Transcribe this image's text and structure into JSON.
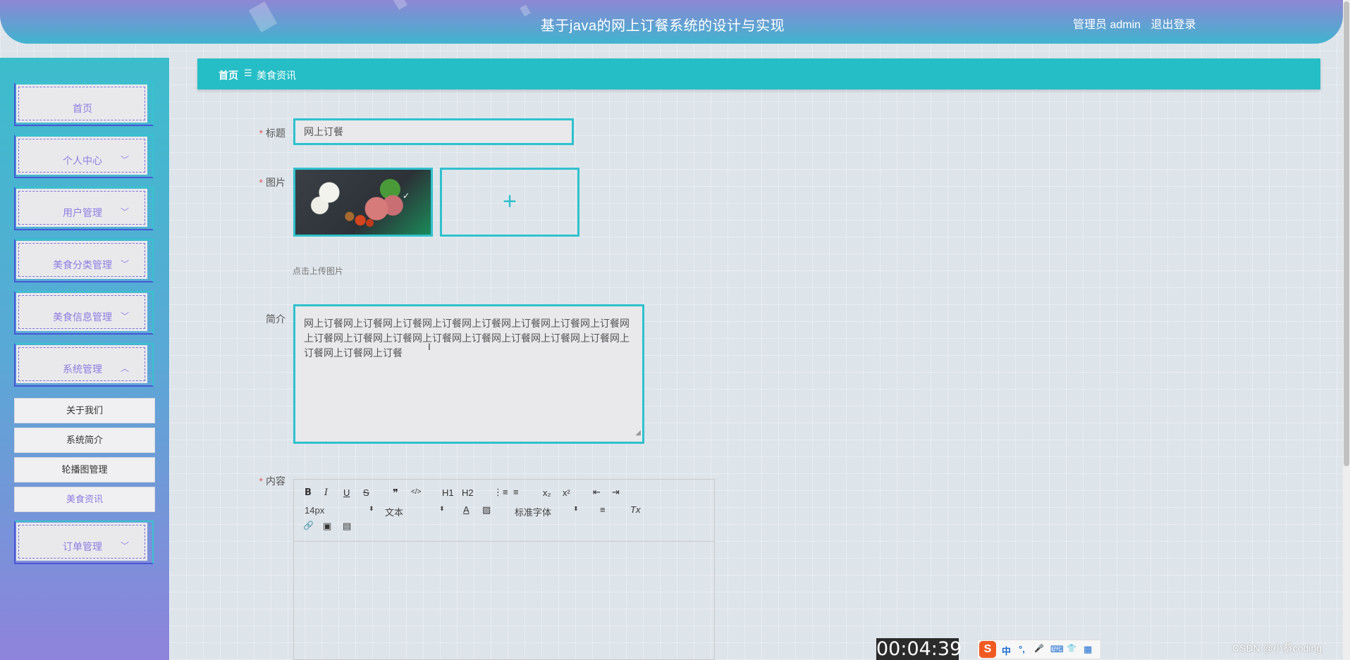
{
  "header": {
    "title": "基于java的网上订餐系统的设计与实现",
    "user": "管理员 admin",
    "logout": "退出登录"
  },
  "sidebar": {
    "items": [
      {
        "label": "首页",
        "chevron": ""
      },
      {
        "label": "个人中心",
        "chevron": "﹀"
      },
      {
        "label": "用户管理",
        "chevron": "﹀"
      },
      {
        "label": "美食分类管理",
        "chevron": "﹀"
      },
      {
        "label": "美食信息管理",
        "chevron": "﹀"
      },
      {
        "label": "系统管理",
        "chevron": "︿"
      }
    ],
    "subitems": [
      {
        "label": "关于我们"
      },
      {
        "label": "系统简介"
      },
      {
        "label": "轮播图管理"
      },
      {
        "label": "美食资讯"
      }
    ],
    "order": {
      "label": "订单管理",
      "chevron": "﹀"
    }
  },
  "breadcrumb": {
    "home": "首页",
    "separator": "☰",
    "current": "美食资讯"
  },
  "form": {
    "title_label": "标题",
    "title_value": "网上订餐",
    "image_label": "图片",
    "upload_hint": "点击上传图片",
    "intro_label": "简介",
    "intro_value": "网上订餐网上订餐网上订餐网上订餐网上订餐网上订餐网上订餐网上订餐网上订餐网上订餐网上订餐网上订餐网上订餐网上订餐网上订餐网上订餐网上订餐网上订餐网上订餐",
    "content_label": "内容",
    "required_mark": "*"
  },
  "editor": {
    "row1": [
      "B",
      "I",
      "U",
      "S",
      "❞",
      "</>",
      "H1",
      "H2",
      "⋮≡",
      "≡",
      "x₂",
      "x²",
      "⇤",
      "⇥"
    ],
    "font_size": "14px",
    "text_type": "文本",
    "font_family": "标准字体",
    "select_arrow": "⬍",
    "row2_icons": [
      "A",
      "▨",
      "≡",
      "Tx"
    ],
    "row3_icons": [
      "🔗",
      "▣",
      "▤"
    ]
  },
  "overlays": {
    "timer": "00:04:39",
    "ime_logo": "S",
    "ime_items": [
      "中",
      "°,",
      "🎤",
      "⌨",
      "👕",
      "▦"
    ],
    "watermark": "CSDN @小蔡coding"
  }
}
